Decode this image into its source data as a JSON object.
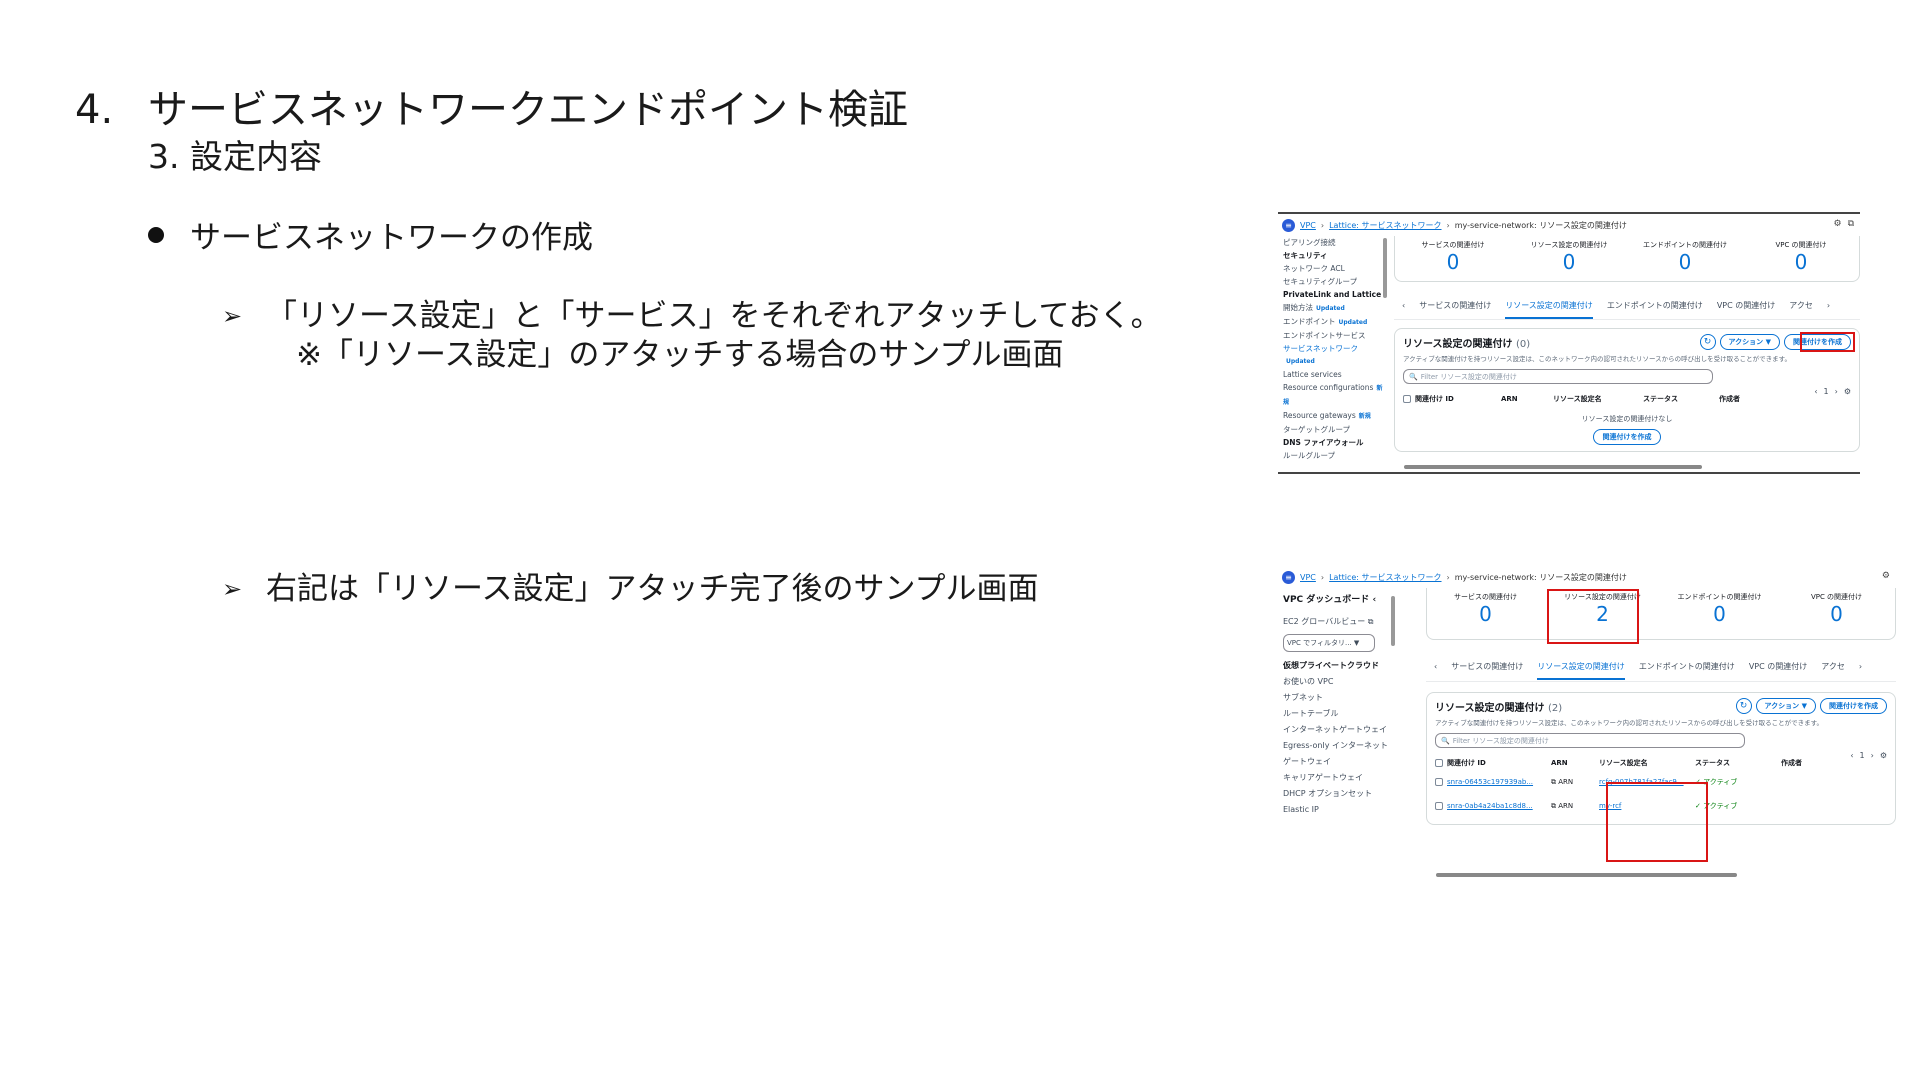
{
  "slide": {
    "title_number": "4.",
    "title": "サービスネットワークエンドポイント検証",
    "subtitle": "3. 設定内容",
    "bullet": "サービスネットワークの作成",
    "sub_bullet_1": "「リソース設定」と「サービス」をそれぞれアタッチしておく。",
    "sub_bullet_1_note": "※「リソース設定」のアタッチする場合のサンプル画面",
    "sub_bullet_2": "右記は「リソース設定」アタッチ完了後のサンプル画面",
    "arrow_glyph": "➢"
  },
  "screenshot1": {
    "breadcrumb": {
      "vpc": "VPC",
      "lattice": "Lattice: サービスネットワーク",
      "current": "my-service-network: リソース設定の関連付け"
    },
    "sidebar": [
      {
        "label": "ピアリング接続",
        "type": "item"
      },
      {
        "label": "セキュリティ",
        "type": "section"
      },
      {
        "label": "ネットワーク ACL",
        "type": "item"
      },
      {
        "label": "セキュリティグループ",
        "type": "item"
      },
      {
        "label": "PrivateLink and Lattice",
        "type": "section"
      },
      {
        "label": "開始方法",
        "type": "item",
        "badge": "Updated"
      },
      {
        "label": "エンドポイント",
        "type": "item",
        "badge": "Updated"
      },
      {
        "label": "エンドポイントサービス",
        "type": "item"
      },
      {
        "label": "サービスネットワーク",
        "type": "active"
      },
      {
        "label": "Updated",
        "type": "active"
      },
      {
        "label": "Lattice services",
        "type": "item"
      },
      {
        "label": "Resource configurations",
        "type": "item",
        "badge": "新規"
      },
      {
        "label": "Resource gateways",
        "type": "item",
        "badge": "新規"
      },
      {
        "label": "ターゲットグループ",
        "type": "item"
      },
      {
        "label": "DNS ファイアウォール",
        "type": "section"
      },
      {
        "label": "ルールグループ",
        "type": "item"
      }
    ],
    "stats": [
      {
        "label": "サービスの関連付け",
        "value": "0"
      },
      {
        "label": "リソース設定の関連付け",
        "value": "0"
      },
      {
        "label": "エンドポイントの関連付け",
        "value": "0"
      },
      {
        "label": "VPC の関連付け",
        "value": "0"
      }
    ],
    "tabs": [
      "サービスの関連付け",
      "リソース設定の関連付け",
      "エンドポイントの関連付け",
      "VPC の関連付け",
      "アクセ"
    ],
    "active_tab": 1,
    "panel": {
      "title": "リソース設定の関連付け",
      "count": "(0)",
      "description": "アクティブな関連付けを持つリソース設定は、このネットワーク内の認可されたリソースからの呼び出しを受け取ることができます。",
      "actions_label": "アクション ▼",
      "create_label": "関連付けを作成",
      "filter_placeholder": "Filter リソース設定の関連付け",
      "page": "1",
      "columns": [
        "関連付け ID",
        "ARN",
        "リソース設定名",
        "ステータス",
        "作成者"
      ],
      "empty_text": "リソース設定の関連付けなし",
      "empty_button": "関連付けを作成"
    }
  },
  "screenshot2": {
    "breadcrumb": {
      "vpc": "VPC",
      "lattice": "Lattice: サービスネットワーク",
      "current": "my-service-network: リソース設定の関連付け"
    },
    "sidebar": [
      {
        "label": "VPC ダッシュボード",
        "type": "section"
      },
      {
        "label": "EC2 グローバルビュー",
        "type": "item"
      },
      {
        "label": "VPC でフィルタリ...",
        "type": "select"
      },
      {
        "label": "仮想プライベートクラウド",
        "type": "section"
      },
      {
        "label": "お使いの VPC",
        "type": "item"
      },
      {
        "label": "サブネット",
        "type": "item"
      },
      {
        "label": "ルートテーブル",
        "type": "item"
      },
      {
        "label": "インターネットゲートウェイ",
        "type": "item"
      },
      {
        "label": "Egress-only インターネットゲートウェイ",
        "type": "item"
      },
      {
        "label": "キャリアゲートウェイ",
        "type": "item"
      },
      {
        "label": "DHCP オプションセット",
        "type": "item"
      },
      {
        "label": "Elastic IP",
        "type": "item"
      }
    ],
    "stats": [
      {
        "label": "サービスの関連付け",
        "value": "0"
      },
      {
        "label": "リソース設定の関連付け",
        "value": "2"
      },
      {
        "label": "エンドポイントの関連付け",
        "value": "0"
      },
      {
        "label": "VPC の関連付け",
        "value": "0"
      }
    ],
    "tabs": [
      "サービスの関連付け",
      "リソース設定の関連付け",
      "エンドポイントの関連付け",
      "VPC の関連付け",
      "アクセ"
    ],
    "active_tab": 1,
    "panel": {
      "title": "リソース設定の関連付け",
      "count": "(2)",
      "description": "アクティブな関連付けを持つリソース設定は、このネットワーク内の認可されたリソースからの呼び出しを受け取ることができます。",
      "actions_label": "アクション ▼",
      "create_label": "関連付けを作成",
      "filter_placeholder": "Filter リソース設定の関連付け",
      "page": "1",
      "columns": [
        "関連付け ID",
        "ARN",
        "リソース設定名",
        "ステータス",
        "作成者"
      ],
      "rows": [
        {
          "id": "snra-06453c197939ab...",
          "arn": "ARN",
          "name": "rcfg-007b781fa27fac9...",
          "status": "アクティブ"
        },
        {
          "id": "snra-0ab4a24ba1c8d8...",
          "arn": "ARN",
          "name": "my-rcf",
          "status": "アクティブ"
        }
      ]
    }
  }
}
